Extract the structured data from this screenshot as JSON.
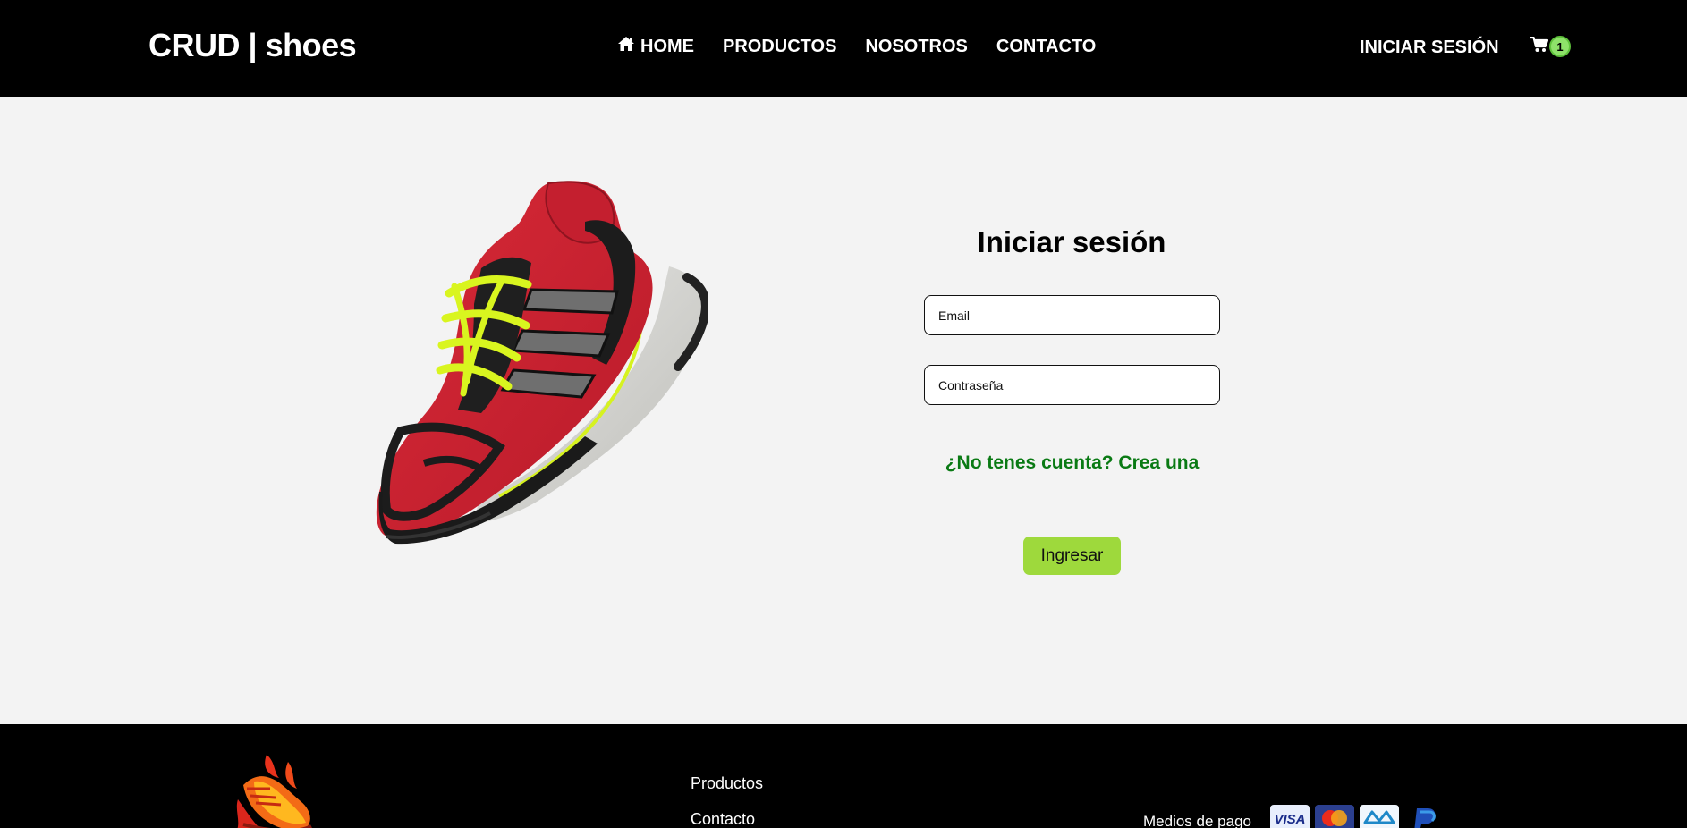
{
  "nav": {
    "brand": "CRUD | shoes",
    "links": [
      {
        "label": "HOME",
        "icon": "home-icon"
      },
      {
        "label": "PRODUCTOS"
      },
      {
        "label": "NOSOTROS"
      },
      {
        "label": "CONTACTO"
      }
    ],
    "login_label": "INICIAR SESIÓN",
    "cart_count": "1"
  },
  "login": {
    "title": "Iniciar sesión",
    "email_placeholder": "Email",
    "password_placeholder": "Contraseña",
    "register_text": "¿No tenes cuenta? Crea una",
    "submit_label": "Ingresar"
  },
  "footer": {
    "links": [
      "Productos",
      "Contacto"
    ],
    "payment_label": "Medios de pago",
    "payment_icons": [
      "visa-icon",
      "mastercard-icon",
      "mercadopago-icon",
      "paypal-icon"
    ]
  },
  "colors": {
    "navbar_bg": "#000000",
    "page_bg": "#f3f3f3",
    "accent_green": "#9ed93c",
    "link_green": "#0a7a14",
    "badge_green": "#8ee26a"
  }
}
